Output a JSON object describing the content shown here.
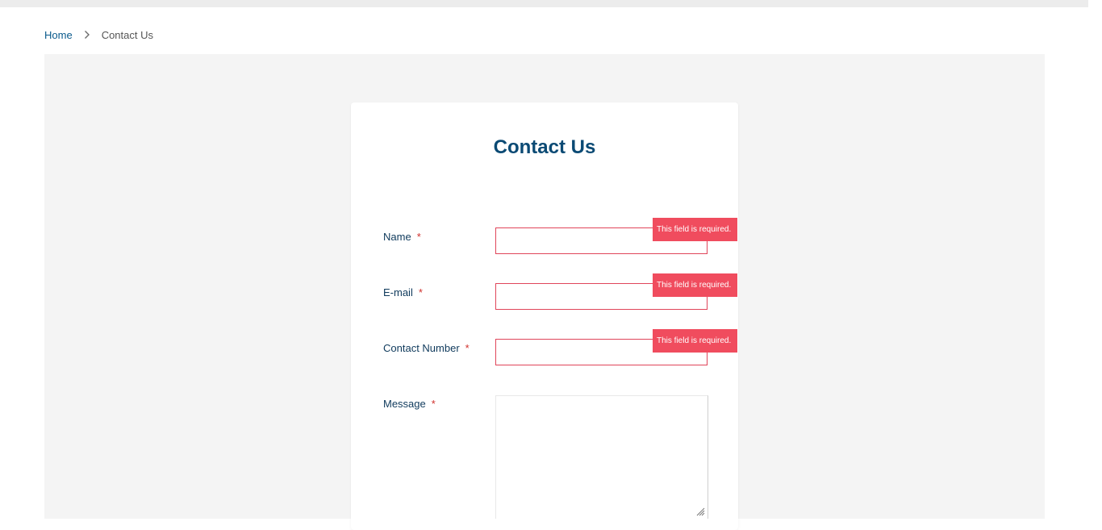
{
  "breadcrumb": {
    "home": "Home",
    "separator_icon": "chevron-right-icon",
    "current": "Contact Us"
  },
  "form": {
    "title": "Contact Us",
    "required_marker": "*",
    "fields": {
      "name": {
        "label": "Name",
        "value": "",
        "error": "This field is required."
      },
      "email": {
        "label": "E-mail",
        "value": "",
        "error": "This field is required."
      },
      "contact_number": {
        "label": "Contact Number",
        "value": "",
        "error": "This field is required."
      },
      "message": {
        "label": "Message",
        "value": ""
      }
    }
  },
  "colors": {
    "title": "#0b4a74",
    "link": "#0a5a8c",
    "error": "#f04c5e",
    "required": "#d0312d",
    "panel": "#f4f4f4"
  }
}
